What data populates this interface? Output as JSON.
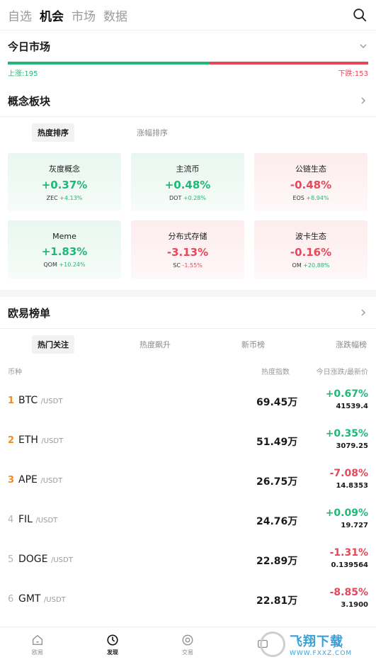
{
  "nav": {
    "tabs": [
      "自选",
      "机会",
      "市场",
      "数据"
    ]
  },
  "market_today": {
    "title": "今日市场",
    "up_label": "上涨:195",
    "down_label": "下跌:153",
    "up_count": 195,
    "down_count": 153
  },
  "concepts": {
    "title": "概念板块",
    "sort_tabs": [
      "热度排序",
      "涨幅排序"
    ],
    "cards": [
      {
        "name": "灰度概念",
        "pct": "+0.37%",
        "coin": "ZEC",
        "coin_pct": "+4.13%",
        "dir": "up",
        "coin_dir": "up"
      },
      {
        "name": "主流币",
        "pct": "+0.48%",
        "coin": "DOT",
        "coin_pct": "+0.28%",
        "dir": "up",
        "coin_dir": "up"
      },
      {
        "name": "公链生态",
        "pct": "-0.48%",
        "coin": "EOS",
        "coin_pct": "+8.94%",
        "dir": "down",
        "coin_dir": "up"
      },
      {
        "name": "Meme",
        "pct": "+1.83%",
        "coin": "QOM",
        "coin_pct": "+10.24%",
        "dir": "up",
        "coin_dir": "up"
      },
      {
        "name": "分布式存储",
        "pct": "-3.13%",
        "coin": "SC",
        "coin_pct": "-1.55%",
        "dir": "down",
        "coin_dir": "down"
      },
      {
        "name": "波卡生态",
        "pct": "-0.16%",
        "coin": "OM",
        "coin_pct": "+20.88%",
        "dir": "down",
        "coin_dir": "up"
      }
    ]
  },
  "ranking": {
    "title": "欧易榜单",
    "tabs": [
      "热门关注",
      "热度飙升",
      "新币榜",
      "涨跌幅榜"
    ],
    "headers": {
      "coin": "币种",
      "heat": "热度指数",
      "change": "今日涨跌/最新价"
    },
    "rows": [
      {
        "rank": "1",
        "symbol": "BTC",
        "quote": "/USDT",
        "heat": "69.45万",
        "change": "+0.67%",
        "price": "41539.4",
        "dir": "up"
      },
      {
        "rank": "2",
        "symbol": "ETH",
        "quote": "/USDT",
        "heat": "51.49万",
        "change": "+0.35%",
        "price": "3079.25",
        "dir": "up"
      },
      {
        "rank": "3",
        "symbol": "APE",
        "quote": "/USDT",
        "heat": "26.75万",
        "change": "-7.08%",
        "price": "14.8353",
        "dir": "down"
      },
      {
        "rank": "4",
        "symbol": "FIL",
        "quote": "/USDT",
        "heat": "24.76万",
        "change": "+0.09%",
        "price": "19.727",
        "dir": "up"
      },
      {
        "rank": "5",
        "symbol": "DOGE",
        "quote": "/USDT",
        "heat": "22.89万",
        "change": "-1.31%",
        "price": "0.139564",
        "dir": "down"
      },
      {
        "rank": "6",
        "symbol": "GMT",
        "quote": "/USDT",
        "heat": "22.81万",
        "change": "-8.85%",
        "price": "3.1900",
        "dir": "down"
      }
    ]
  },
  "bottom_nav": {
    "items": [
      {
        "label": "欧易",
        "icon": "home-icon"
      },
      {
        "label": "发现",
        "icon": "discover-icon"
      },
      {
        "label": "交易",
        "icon": "trade-icon"
      },
      {
        "label": "",
        "icon": "assets-icon"
      },
      {
        "label": "",
        "icon": "profile-icon"
      }
    ]
  },
  "watermark": {
    "brand": "飞翔下载",
    "url": "WWW.FXXZ.COM"
  },
  "colors": {
    "up": "#1eb877",
    "down": "#e5475b",
    "rank_hot": "#f08a24"
  }
}
